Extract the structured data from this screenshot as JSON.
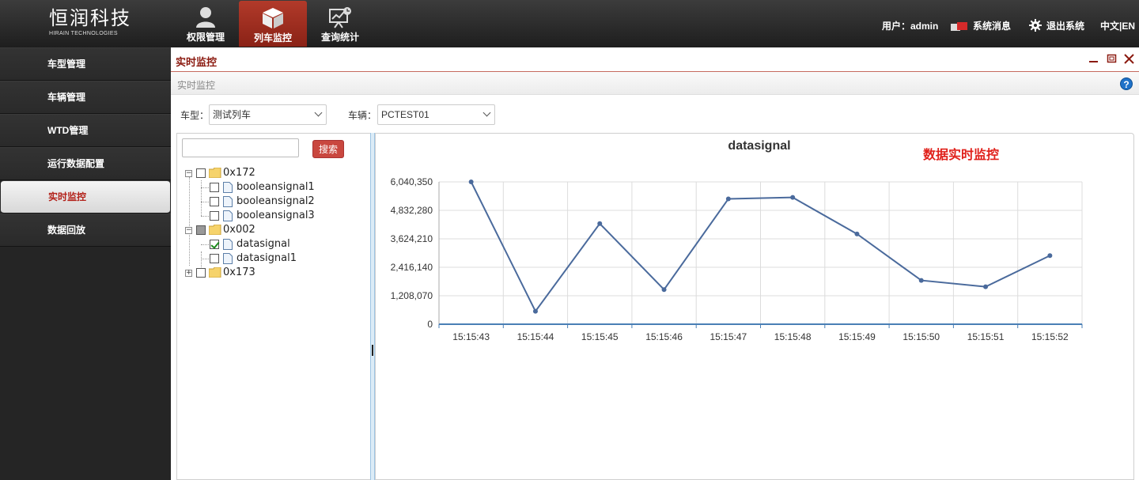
{
  "header": {
    "logo_cn": "恒润科技",
    "logo_en": "HIRAIN TECHNOLOGIES",
    "nav": [
      {
        "label": "权限管理",
        "icon": "user-icon"
      },
      {
        "label": "列车监控",
        "icon": "cube-icon",
        "active": true
      },
      {
        "label": "查询统计",
        "icon": "stats-board-icon"
      }
    ],
    "user_text": "用户：admin",
    "messages_label": "系统消息",
    "logout_label": "退出系统",
    "lang_label": "中文|EN",
    "accent": "#9e2b1c"
  },
  "sidebar": {
    "items": [
      {
        "label": "车型管理"
      },
      {
        "label": "车辆管理"
      },
      {
        "label": "WTD管理"
      },
      {
        "label": "运行数据配置"
      },
      {
        "label": "实时监控",
        "active": true
      },
      {
        "label": "数据回放"
      }
    ]
  },
  "panel": {
    "title": "实时监控",
    "breadcrumb": "实时监控",
    "help": "?"
  },
  "filters": {
    "model_label": "车型：",
    "model_value": "测试列车",
    "vehicle_label": "车辆：",
    "vehicle_value": "PCTEST01"
  },
  "tree": {
    "search_value": "",
    "search_button": "搜索",
    "nodes": [
      {
        "label": "0x172",
        "expanded": true,
        "state": "unchecked",
        "children": [
          {
            "label": "booleansignal1",
            "state": "unchecked"
          },
          {
            "label": "booleansignal2",
            "state": "unchecked"
          },
          {
            "label": "booleansignal3",
            "state": "unchecked"
          }
        ]
      },
      {
        "label": "0x002",
        "expanded": true,
        "state": "partial",
        "children": [
          {
            "label": "datasignal",
            "state": "checked"
          },
          {
            "label": "datasignal1",
            "state": "unchecked"
          }
        ]
      },
      {
        "label": "0x173",
        "expanded": false,
        "state": "unchecked",
        "children": []
      }
    ]
  },
  "chart_note": "数据实时监控",
  "chart_data": {
    "type": "line",
    "title": "datasignal",
    "categories": [
      "15:15:43",
      "15:15:44",
      "15:15:45",
      "15:15:46",
      "15:15:47",
      "15:15:48",
      "15:15:49",
      "15:15:50",
      "15:15:51",
      "15:15:52"
    ],
    "series": [
      {
        "values": [
          6040350,
          550000,
          4270000,
          1470000,
          5320000,
          5380000,
          3830000,
          1860000,
          1590000,
          2910000
        ],
        "color": "#4a6a9c"
      }
    ],
    "yticks": [
      "0",
      "1,208,070",
      "2,416,140",
      "3,624,210",
      "4,832,280",
      "6,040,350"
    ],
    "ylim": [
      0,
      6040350
    ],
    "grid": true
  }
}
